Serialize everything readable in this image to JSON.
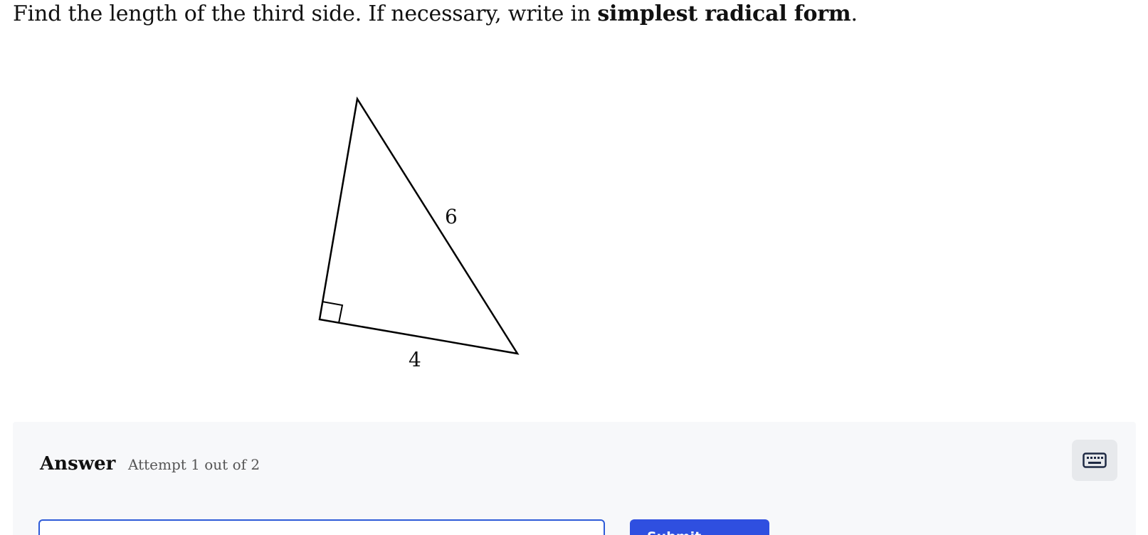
{
  "question": {
    "prefix": "Find the length of the third side. If necessary, write in ",
    "emphasis": "simplest radical form",
    "suffix": "."
  },
  "diagram": {
    "hypotenuse_label": "6",
    "leg_label": "4"
  },
  "answer": {
    "heading": "Answer",
    "attempt_text": "Attempt 1 out of 2",
    "input_value": "",
    "submit_label": "Submit Answer",
    "keyboard_icon": "keyboard-icon"
  },
  "colors": {
    "accent": "#2f4fe0",
    "input_border": "#2e5bd8",
    "panel_bg": "#f7f8fa"
  }
}
